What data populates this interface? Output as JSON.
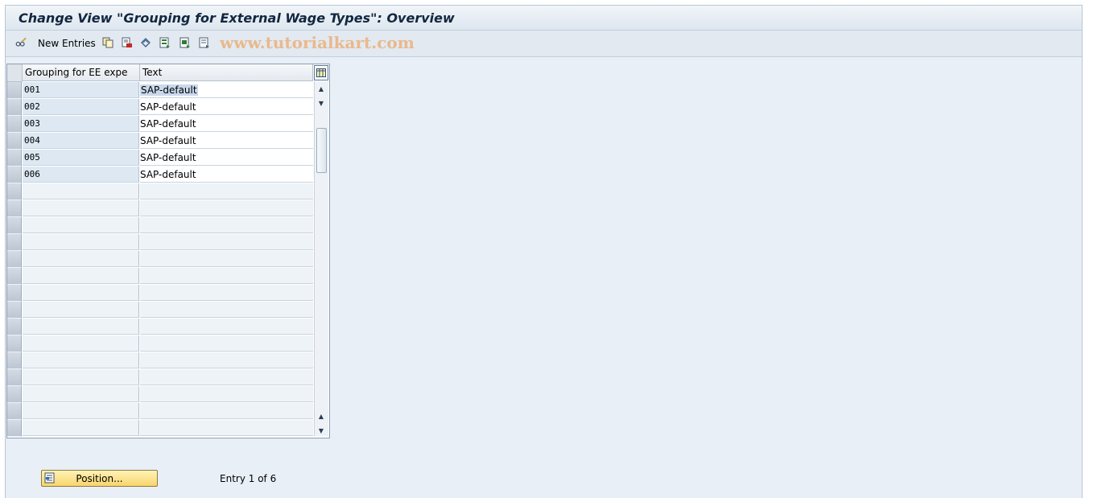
{
  "title": "Change View \"Grouping for External Wage Types\": Overview",
  "toolbar": {
    "new_entries_label": "New Entries",
    "icons": [
      "glasses-pencil-icon",
      "copy-icon",
      "delete-icon",
      "undo-icon",
      "select-all-icon",
      "select-block-icon",
      "deselect-all-icon"
    ],
    "watermark": "www.tutorialkart.com"
  },
  "table": {
    "columns": [
      "Grouping for EE expe",
      "Text"
    ],
    "rows": [
      {
        "key": "001",
        "text": "SAP-default"
      },
      {
        "key": "002",
        "text": "SAP-default"
      },
      {
        "key": "003",
        "text": "SAP-default"
      },
      {
        "key": "004",
        "text": "SAP-default"
      },
      {
        "key": "005",
        "text": "SAP-default"
      },
      {
        "key": "006",
        "text": "SAP-default"
      }
    ]
  },
  "footer": {
    "position_label": "Position...",
    "entry_info": "Entry 1 of 6"
  }
}
